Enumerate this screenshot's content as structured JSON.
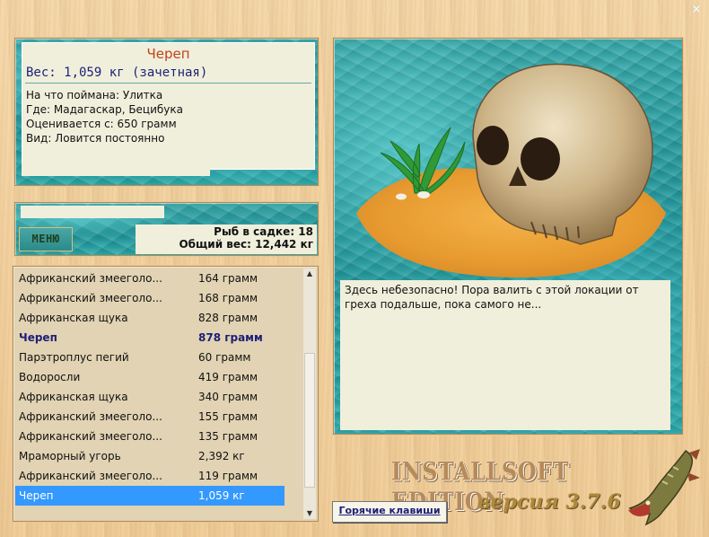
{
  "close_glyph": "✕",
  "info": {
    "title": "Череп",
    "weight": "Вес: 1,059 кг (зачетная)",
    "bait": "На что поймана: Улитка",
    "where": "Где: Мадагаскар, Бецибука",
    "valued": "Оценивается с: 650 грамм",
    "kind": "Вид: Ловится постоянно"
  },
  "stats": {
    "menu_label": "МЕНЮ",
    "fish_in_keepnet": "Рыб в садке: 18",
    "total_weight": "Общий вес: 12,442 кг"
  },
  "catch_list": [
    {
      "name": "Африканский змееголо...",
      "weight": "164 грамм"
    },
    {
      "name": "Африканский змееголо...",
      "weight": "168 грамм"
    },
    {
      "name": "Африканская щука",
      "weight": "828 грамм"
    },
    {
      "name": "Череп",
      "weight": "878 грамм",
      "trophy": true
    },
    {
      "name": "Парэтроплус пегий",
      "weight": "60 грамм"
    },
    {
      "name": "Водоросли",
      "weight": "419 грамм"
    },
    {
      "name": "Африканская щука",
      "weight": "340 грамм"
    },
    {
      "name": "Африканский змееголо...",
      "weight": "155 грамм"
    },
    {
      "name": "Африканский змееголо...",
      "weight": "135 грамм"
    },
    {
      "name": "Мраморный угорь",
      "weight": "2,392 кг"
    },
    {
      "name": "Африканский змееголо...",
      "weight": "119 грамм"
    },
    {
      "name": "Череп",
      "weight": "1,059 кг",
      "selected": true
    }
  ],
  "scroll_arrows": {
    "up": "▲",
    "down": "▼"
  },
  "message": "Здесь небезопасно! Пора валить с этой локации от греха подальше, пока самого не...",
  "branding": {
    "edition": "INSTALLSOFT EDITION",
    "version": "версия 3.7.6"
  },
  "hotkeys_label": "Горячие клавиши",
  "colors": {
    "trophy": "#1c1f77",
    "title": "#c2411a",
    "selection": "#3399ff",
    "panel": "#f0efdc"
  }
}
